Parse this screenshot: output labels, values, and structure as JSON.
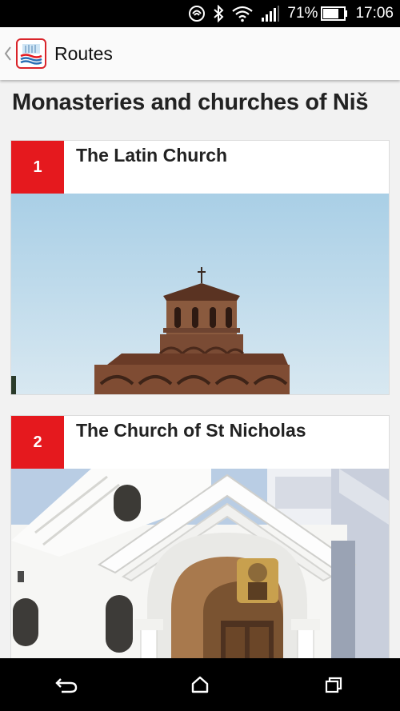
{
  "status_bar": {
    "battery_percent": "71%",
    "time": "17:06",
    "icons": [
      "nfc-icon",
      "bluetooth-icon",
      "wifi-icon",
      "signal-icon",
      "battery-icon"
    ]
  },
  "app_bar": {
    "title": "Routes",
    "up_icon": "chevron-left-icon",
    "logo_icon": "app-logo-icon"
  },
  "page": {
    "heading": "Monasteries and churches of Niš"
  },
  "routes": [
    {
      "number": "1",
      "title": "The Latin Church"
    },
    {
      "number": "2",
      "title": "The Church of St Nicholas"
    }
  ],
  "nav_bar": {
    "icons": [
      "back-icon",
      "home-icon",
      "recents-icon"
    ]
  },
  "colors": {
    "accent": "#e5191e",
    "status_bar_bg": "#000000",
    "page_bg": "#f2f2f2"
  }
}
